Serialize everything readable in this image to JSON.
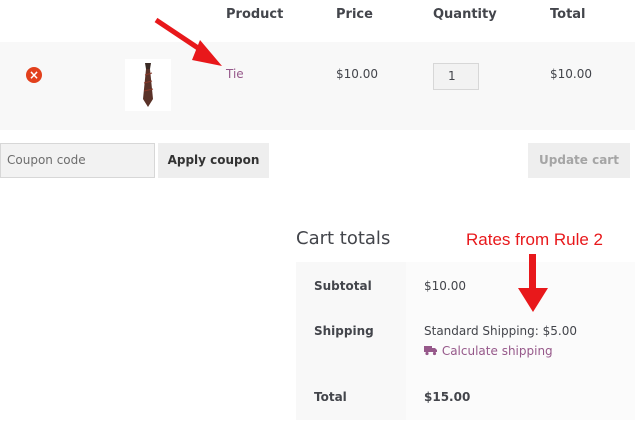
{
  "table": {
    "headers": [
      "Product",
      "Price",
      "Quantity",
      "Total"
    ],
    "row": {
      "remove_icon": "×",
      "product_name": "Tie",
      "price": "$10.00",
      "quantity": "1",
      "total": "$10.00"
    }
  },
  "coupon": {
    "placeholder": "Coupon code",
    "apply_label": "Apply coupon"
  },
  "update_label": "Update cart",
  "cart_totals": {
    "title": "Cart totals",
    "subtotal_label": "Subtotal",
    "subtotal_value": "$10.00",
    "shipping_label": "Shipping",
    "shipping_value": "Standard Shipping: $5.00",
    "calculate_label": "Calculate shipping",
    "total_label": "Total",
    "total_value": "$15.00"
  },
  "annotation": {
    "text": "Rates from Rule 2",
    "color": "#e8181b"
  },
  "colors": {
    "link": "#96588a",
    "remove": "#e2401c"
  }
}
